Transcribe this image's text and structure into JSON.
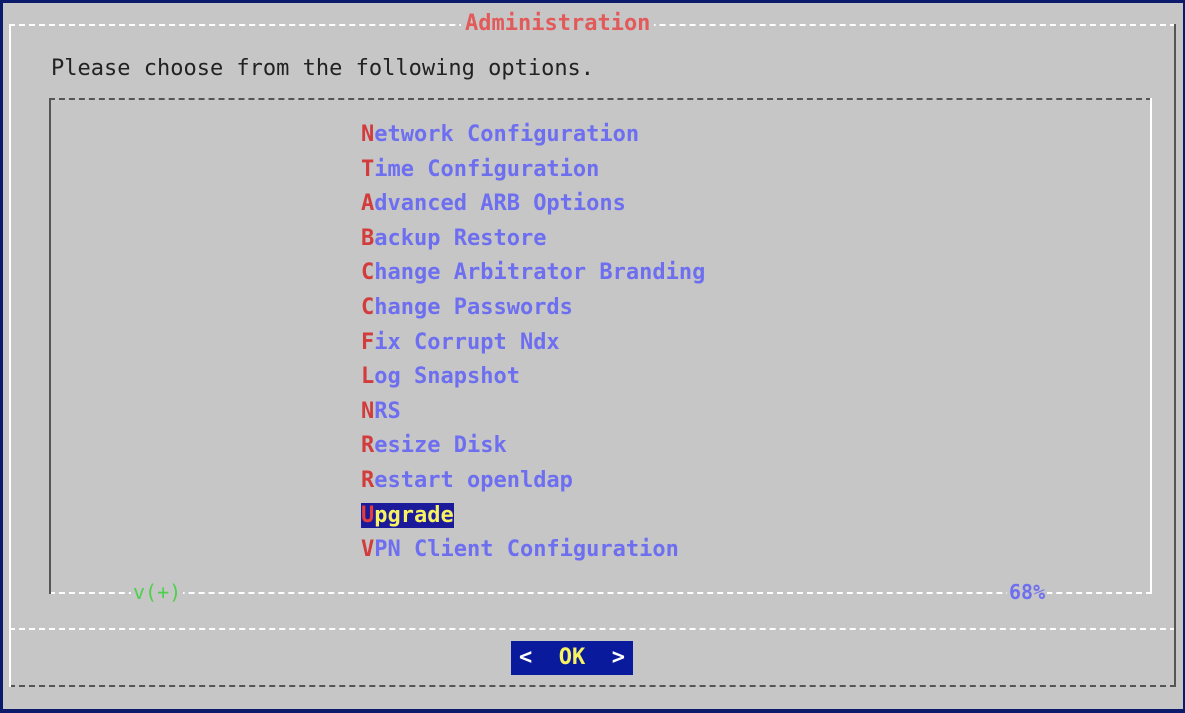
{
  "dialog": {
    "title": "Administration",
    "prompt": "Please choose from the following options."
  },
  "menu": {
    "items": [
      {
        "hot": "N",
        "rest": "etwork Configuration"
      },
      {
        "hot": "T",
        "rest": "ime Configuration"
      },
      {
        "hot": "A",
        "rest": "dvanced ARB Options"
      },
      {
        "hot": "B",
        "rest": "ackup Restore"
      },
      {
        "hot": "C",
        "rest": "hange Arbitrator Branding"
      },
      {
        "hot": "C",
        "rest": "hange Passwords"
      },
      {
        "hot": "F",
        "rest": "ix Corrupt Ndx"
      },
      {
        "hot": "L",
        "rest": "og Snapshot"
      },
      {
        "hot": "N",
        "rest": "RS"
      },
      {
        "hot": "R",
        "rest": "esize Disk"
      },
      {
        "hot": "R",
        "rest": "estart openldap"
      },
      {
        "hot": "U",
        "rest": "pgrade"
      },
      {
        "hot": "V",
        "rest": "PN Client Configuration"
      }
    ],
    "selected_index": 11,
    "scroll_indicator": "v(+)",
    "scroll_percent": "68%"
  },
  "buttons": {
    "ok_left": "<",
    "ok_hot": "O",
    "ok_rest": "K",
    "ok_right": ">"
  },
  "colors": {
    "background": "#c6c6c6",
    "hotkey": "#d23c3c",
    "menu_text": "#6d6ff0",
    "selected_bg": "#1a1a9a",
    "selected_text": "#f7f260",
    "screen_bg": "#0b1a6b"
  }
}
